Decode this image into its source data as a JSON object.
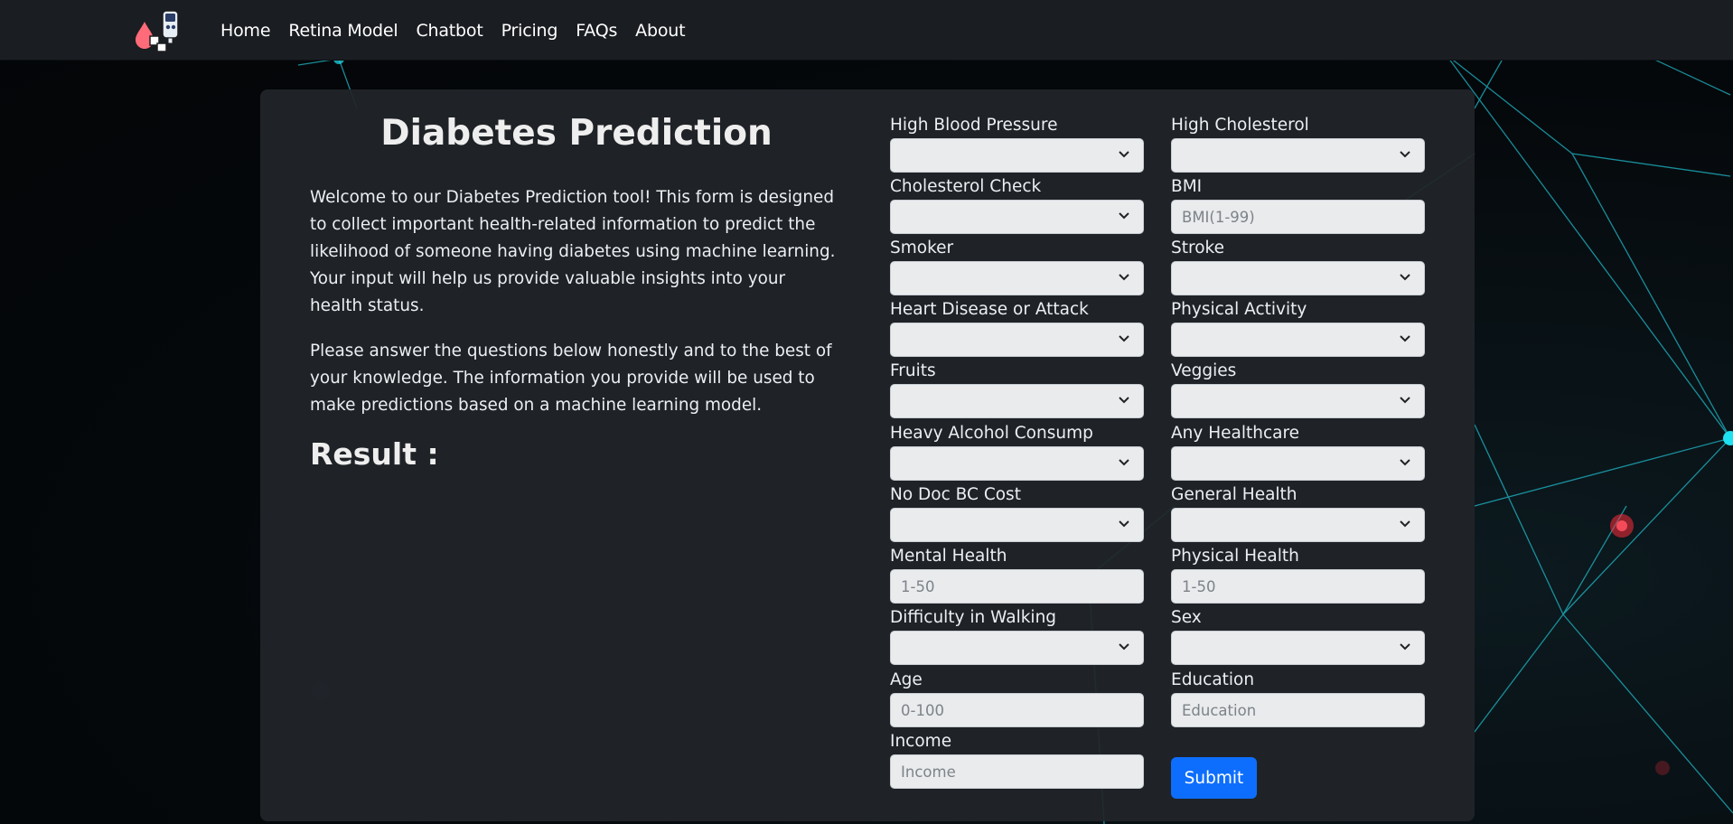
{
  "nav": {
    "logo": "glucometer-logo",
    "links": [
      "Home",
      "Retina Model",
      "Chatbot",
      "Pricing",
      "FAQs",
      "About"
    ]
  },
  "intro": {
    "title": "Diabetes Prediction",
    "paragraph1": "Welcome to our Diabetes Prediction tool! This form is designed to collect important health-related information to predict the likelihood of someone having diabetes using machine learning. Your input will help us provide valuable insights into your health status.",
    "paragraph2": "Please answer the questions below honestly and to the best of your knowledge. The information you provide will be used to make predictions based on a machine learning model.",
    "result_label": "Result :"
  },
  "form": {
    "high_bp": {
      "label": "High Blood Pressure"
    },
    "high_chol": {
      "label": "High Cholesterol"
    },
    "chol_check": {
      "label": "Cholesterol Check"
    },
    "bmi": {
      "label": "BMI",
      "placeholder": "BMI(1-99)"
    },
    "smoker": {
      "label": "Smoker"
    },
    "stroke": {
      "label": "Stroke"
    },
    "heart_disease": {
      "label": "Heart Disease or Attack"
    },
    "phys_activity": {
      "label": "Physical Activity"
    },
    "fruits": {
      "label": "Fruits"
    },
    "veggies": {
      "label": "Veggies"
    },
    "heavy_alcohol": {
      "label": "Heavy Alcohol Consump"
    },
    "any_healthcare": {
      "label": "Any Healthcare"
    },
    "no_doc_cost": {
      "label": "No Doc BC Cost"
    },
    "gen_health": {
      "label": "General Health"
    },
    "mental_health": {
      "label": "Mental Health",
      "placeholder": "1-50"
    },
    "physical_health": {
      "label": "Physical Health",
      "placeholder": "1-50"
    },
    "diff_walk": {
      "label": "Difficulty in Walking"
    },
    "sex": {
      "label": "Sex"
    },
    "age": {
      "label": "Age",
      "placeholder": "0-100"
    },
    "education": {
      "label": "Education",
      "placeholder": "Education"
    },
    "income": {
      "label": "Income",
      "placeholder": "Income"
    },
    "submit_label": "Submit"
  },
  "colors": {
    "accent": "#0d6efd",
    "navbar": "#1a1d21",
    "card": "#212529",
    "network_line": "#1fd6e6",
    "glow_red": "#ff2b3a"
  }
}
